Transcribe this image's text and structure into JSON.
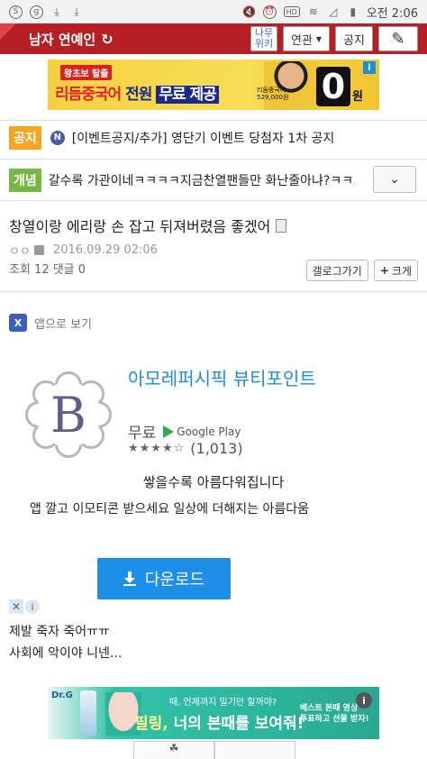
{
  "statusbar": {
    "left_icons": [
      "s-icon",
      "g-icon",
      "download-icon",
      "download-icon"
    ],
    "right_icons": [
      "mute-icon",
      "alarm-icon",
      "hd-icon",
      "wifi-icon",
      "signal-icon",
      "battery-icon"
    ],
    "time": "오전 2:06",
    "hd": "HD"
  },
  "gallery_bar": {
    "title": "남자 연예인",
    "refresh_icon": "refresh-icon",
    "btn_wiki": "나무\n위키",
    "btn_related": "연관",
    "btn_notice": "공지",
    "btn_write_icon": "pencil-icon"
  },
  "top_ad": {
    "badge": "왕초보 탈출",
    "headline_a": "리듬중국어 ",
    "headline_b": "전원 ",
    "headline_c": "무료 제공",
    "small": "리듬중국어\n529,000원",
    "zero": "0",
    "won": "원",
    "info": "i"
  },
  "notice": {
    "tag": "공지",
    "badge": "N",
    "text": "[이벤트공지/추가] 영단기 이벤트 당첨자 1차 공지"
  },
  "concept": {
    "tag": "개념",
    "text": "갈수록 가관이네ㅋㅋㅋㅋ지금찬열팬들만 화난줄아냐?ㅋㅋ..."
  },
  "post": {
    "title": "창열이랑 에리랑 손 잡고 뒤져버렸음 좋겠어",
    "author": "ㅇㅇ",
    "date": "2016.09.29 02:06",
    "stats": "조회 12 댓글 0",
    "btn_gallery": "갤로그가기",
    "btn_bigger": "크게",
    "plus": "+"
  },
  "app_promo": {
    "view_in_app": "앱으로 보기",
    "app_name": "아모레퍼시픽 뷰티포인트",
    "price": "무료",
    "store": "Google Play",
    "stars": "★★★★☆",
    "rating_count": "(1,013)",
    "slogan": "쌓을수록 아름다워집니다",
    "desc": "앱 깔고 이모티콘 받으세요 일상에 더해지는 아름다움",
    "download": "다운로드",
    "logo_letter": "B"
  },
  "ad_controls": {
    "close": "✕",
    "info": "i"
  },
  "comments": [
    "제발 죽자 죽어ㅠㅠ",
    "사회에 악이야 니넨..."
  ],
  "bottom_ad": {
    "brand": "Dr.G",
    "line1": "때, 언제까지 밀기만 할꺼야?",
    "line2_a": "필링, ",
    "line2_b": "너의 본때를 보여줘!",
    "right": "베스트 본때 영상\n투표하고 선물 받자!",
    "info": "i"
  },
  "colors": {
    "gallery_bar": "#b52026",
    "notice_tag": "#f5a520",
    "concept_tag": "#77b843",
    "accent": "#1e8fe8"
  }
}
